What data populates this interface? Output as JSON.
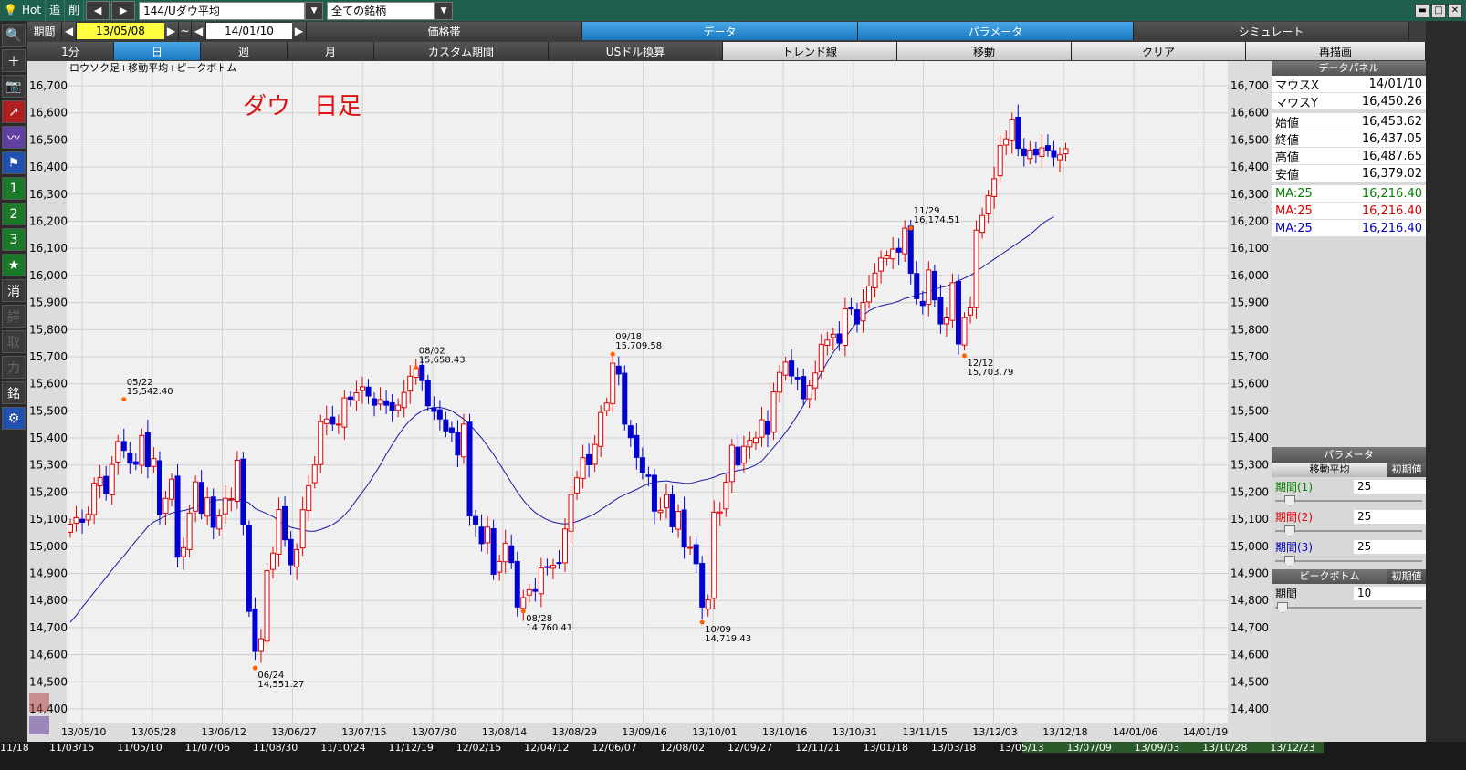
{
  "titlebar": {
    "hot": "Hot",
    "add": "追",
    "del": "削",
    "prev": "◀",
    "next": "▶",
    "symbol": "144/Uダウ平均",
    "universe": "全ての銘柄",
    "minimize": "▬",
    "maximize": "□",
    "close": "✕"
  },
  "toolbar1": {
    "period_label": "期間",
    "start_date": "13/05/08",
    "tilde": "~",
    "end_date": "14/01/10",
    "tabs": [
      "価格帯",
      "データ",
      "パラメータ",
      "シミュレート"
    ]
  },
  "toolbar2": {
    "tabs": [
      "1分",
      "日",
      "週",
      "月",
      "カスタム期間",
      "USドル換算",
      "トレンド線",
      "移動",
      "クリア",
      "再描画"
    ]
  },
  "sidebar": {
    "items": [
      "🔍",
      "＋",
      "📷",
      "↗",
      "〰",
      "⚑",
      "1",
      "2",
      "3",
      "★",
      "消",
      "詳",
      "取",
      "力",
      "銘",
      "⚙"
    ]
  },
  "chart_data": {
    "type": "candlestick",
    "subtitle": "ロウソク足+移動平均+ピークボトム",
    "title": "ダウ　日足",
    "ylim": [
      14350,
      16780
    ],
    "yticks": [
      14400,
      14500,
      14600,
      14700,
      14800,
      14900,
      15000,
      15100,
      15200,
      15300,
      15400,
      15500,
      15600,
      15700,
      15800,
      15900,
      16000,
      16100,
      16200,
      16300,
      16400,
      16500,
      16600,
      16700
    ],
    "xlabels": [
      "13/05/10",
      "13/05/28",
      "13/06/12",
      "13/06/27",
      "13/07/15",
      "13/07/30",
      "13/08/14",
      "13/08/29",
      "13/09/16",
      "13/10/01",
      "13/10/16",
      "13/10/31",
      "13/11/15",
      "13/12/03",
      "13/12/18",
      "14/01/06",
      "14/01/19"
    ],
    "peaks": [
      {
        "date": "05/22",
        "value": "15,542.40",
        "pos": "top",
        "i": 9
      },
      {
        "date": "06/24",
        "value": "14,551.27",
        "pos": "bottom",
        "i": 31
      },
      {
        "date": "08/02",
        "value": "15,658.43",
        "pos": "top",
        "i": 58
      },
      {
        "date": "08/28",
        "value": "14,760.41",
        "pos": "bottom",
        "i": 76
      },
      {
        "date": "09/18",
        "value": "15,709.58",
        "pos": "top",
        "i": 91
      },
      {
        "date": "10/09",
        "value": "14,719.43",
        "pos": "bottom",
        "i": 106
      },
      {
        "date": "11/29",
        "value": "16,174.51",
        "pos": "top",
        "i": 141
      },
      {
        "date": "12/12",
        "value": "15,703.79",
        "pos": "bottom",
        "i": 150
      }
    ],
    "close": [
      15082,
      15106,
      15089,
      15118,
      15233,
      15254,
      15195,
      15302,
      15387,
      15354,
      15307,
      15303,
      15409,
      15294,
      15324,
      15116,
      15177,
      15248,
      14960,
      14995,
      15123,
      15238,
      15122,
      15179,
      15070,
      15112,
      15177,
      15176,
      15318,
      15080,
      14760,
      14612,
      14659,
      14910,
      14975,
      15136,
      15024,
      14932,
      14988,
      15135,
      15224,
      15300,
      15460,
      15470,
      15451,
      15451,
      15548,
      15543,
      15567,
      15589,
      15555,
      15521,
      15542,
      15521,
      15502,
      15521,
      15568,
      15628,
      15658,
      15612,
      15519,
      15498,
      15470,
      15426,
      15419,
      15337,
      15451,
      15112,
      15082,
      15010,
      15071,
      14897,
      14944,
      15012,
      14940,
      14776,
      14811,
      14840,
      14834,
      14920,
      14923,
      14930,
      14938,
      15064,
      15191,
      15253,
      15327,
      15301,
      15376,
      15494,
      15529,
      15676,
      15636,
      15451,
      15401,
      15328,
      15273,
      15258,
      15130,
      15133,
      15191,
      15072,
      15129,
      14997,
      14996,
      14936,
      14776,
      14802,
      15126,
      15127,
      15237,
      15373,
      15300,
      15369,
      15392,
      15400,
      15467,
      15413,
      15570,
      15642,
      15680,
      15629,
      15618,
      15545,
      15594,
      15640,
      15746,
      15761,
      15783,
      15750,
      15877,
      15876,
      15821,
      15900,
      15961,
      16009,
      16064,
      16072,
      16097,
      16086,
      16174,
      16008,
      15914,
      15889,
      16020,
      15910,
      15821,
      15843,
      15973,
      15747,
      15844,
      15880,
      16167,
      16221,
      16294,
      16357,
      16479,
      16504,
      16577,
      16469,
      16442,
      16463,
      16445,
      16471,
      16462,
      16437,
      16445,
      16468
    ],
    "ma": [
      14720,
      14745,
      14775,
      14802,
      14830,
      14858,
      14885,
      14913,
      14940,
      14965,
      14993,
      15020,
      15046,
      15072,
      15090,
      15100,
      15112,
      15123,
      15128,
      15132,
      15137,
      15147,
      15153,
      15160,
      15168,
      15172,
      15170,
      15170,
      15175,
      15170,
      15160,
      15140,
      15130,
      15120,
      15110,
      15095,
      15080,
      15070,
      15065,
      15060,
      15056,
      15056,
      15062,
      15070,
      15080,
      15095,
      15115,
      15140,
      15170,
      15200,
      15230,
      15265,
      15300,
      15340,
      15375,
      15410,
      15440,
      15465,
      15485,
      15500,
      15508,
      15512,
      15513,
      15508,
      15500,
      15485,
      15470,
      15450,
      15425,
      15400,
      15370,
      15340,
      15305,
      15270,
      15235,
      15200,
      15170,
      15145,
      15125,
      15110,
      15098,
      15090,
      15085,
      15083,
      15085,
      15092,
      15100,
      15110,
      15120,
      15135,
      15150,
      15165,
      15180,
      15190,
      15200,
      15210,
      15222,
      15230,
      15238,
      15240,
      15242,
      15238,
      15236,
      15232,
      15232,
      15238,
      15244,
      15248,
      15255,
      15264,
      15270,
      15275,
      15280,
      15284,
      15290,
      15300,
      15315,
      15340,
      15365,
      15392,
      15420,
      15450,
      15485,
      15520,
      15560,
      15600,
      15640,
      15680,
      15715,
      15745,
      15770,
      15800,
      15830,
      15850,
      15870,
      15880,
      15888,
      15893,
      15898,
      15905,
      15915,
      15920,
      15928,
      15935,
      15940,
      15948,
      15955,
      15960,
      15970,
      15980,
      15990,
      16000,
      16015,
      16030,
      16045,
      16060,
      16075,
      16090,
      16105,
      16120,
      16135,
      16150,
      16170,
      16190,
      16205,
      16216
    ]
  },
  "data_panel": {
    "title": "データパネル",
    "rows": [
      {
        "label": "マウスX",
        "value": "14/01/10"
      },
      {
        "label": "マウスY",
        "value": "16,450.26"
      },
      {
        "label": "始値",
        "value": "16,453.62"
      },
      {
        "label": "終値",
        "value": "16,437.05"
      },
      {
        "label": "高値",
        "value": "16,487.65"
      },
      {
        "label": "安値",
        "value": "16,379.02"
      }
    ],
    "ma_rows": [
      {
        "label": "MA:25",
        "value": "16,216.40",
        "color": "#008000"
      },
      {
        "label": "MA:25",
        "value": "16,216.40",
        "color": "#e00000"
      },
      {
        "label": "MA:25",
        "value": "16,216.40",
        "color": "#0000c0"
      }
    ]
  },
  "param_panel": {
    "title": "パラメータ",
    "ma_title": "移動平均",
    "reset": "初期値",
    "period1_label": "期間(1)",
    "period1_value": "25",
    "period2_label": "期間(2)",
    "period2_value": "25",
    "period3_label": "期間(3)",
    "period3_value": "25",
    "pb_title": "ピークボトム",
    "pb_period_label": "期間",
    "pb_period_value": "10"
  },
  "timeline": {
    "labels": [
      "11/18",
      "11/03/15",
      "11/05/10",
      "11/07/06",
      "11/08/30",
      "11/10/24",
      "11/12/19",
      "12/02/15",
      "12/04/12",
      "12/06/07",
      "12/08/02",
      "12/09/27",
      "12/11/21",
      "13/01/18",
      "13/03/18",
      "13/05/13",
      "13/07/09",
      "13/09/03",
      "13/10/28",
      "13/12/23"
    ]
  }
}
